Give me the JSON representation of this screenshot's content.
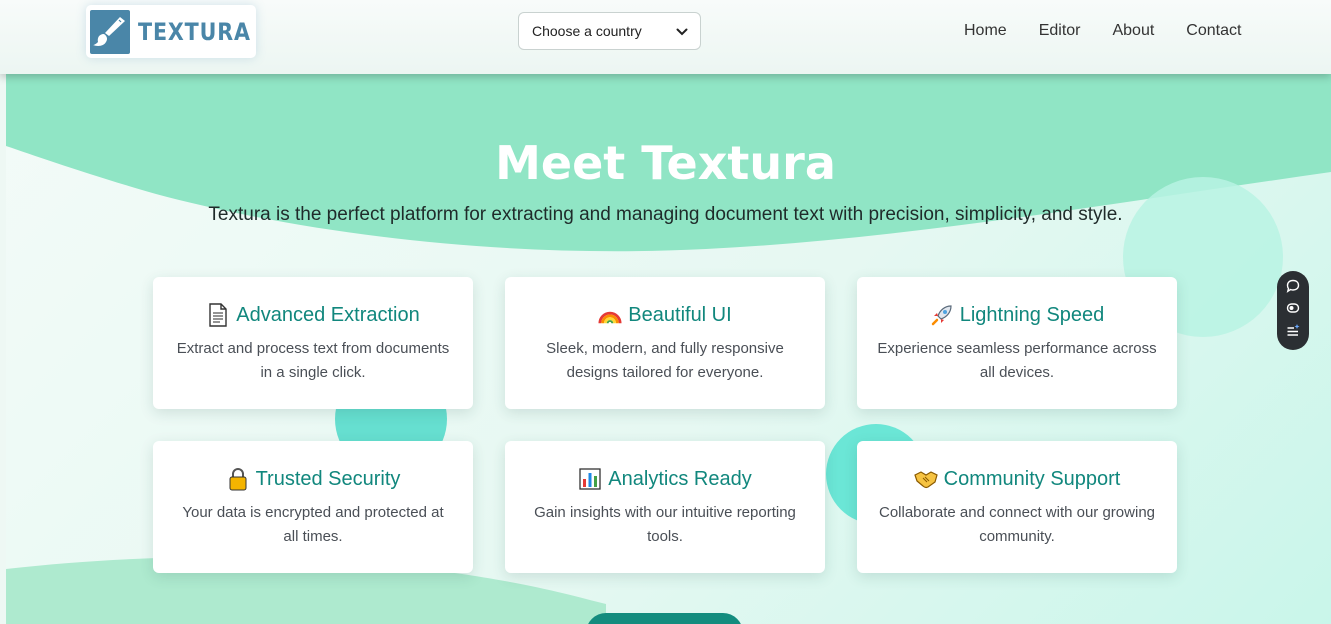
{
  "header": {
    "logo_text": "TEXTURA",
    "country_select": {
      "selected": "Choose a country"
    },
    "nav": [
      "Home",
      "Editor",
      "About",
      "Contact"
    ]
  },
  "hero": {
    "title": "Meet Textura",
    "subtitle": "Textura is the perfect platform for extracting and managing document text with precision, simplicity, and style."
  },
  "features": [
    {
      "icon": "document-icon",
      "title": "Advanced Extraction",
      "description": "Extract and process text from documents in a single click."
    },
    {
      "icon": "rainbow-icon",
      "title": "Beautiful UI",
      "description": "Sleek, modern, and fully responsive designs tailored for everyone."
    },
    {
      "icon": "rocket-icon",
      "title": "Lightning Speed",
      "description": "Experience seamless performance across all devices."
    },
    {
      "icon": "lock-icon",
      "title": "Trusted Security",
      "description": "Your data is encrypted and protected at all times."
    },
    {
      "icon": "bar-chart-icon",
      "title": "Analytics Ready",
      "description": "Gain insights with our intuitive reporting tools."
    },
    {
      "icon": "handshake-icon",
      "title": "Community Support",
      "description": "Collaborate and connect with our growing community."
    }
  ],
  "colors": {
    "accent": "#11877d",
    "wave": "#90e5c5",
    "logo": "#4a86a8"
  },
  "toolbar_icons": [
    "chat-bubble-icon",
    "toggle-icon",
    "list-sparkle-icon"
  ]
}
